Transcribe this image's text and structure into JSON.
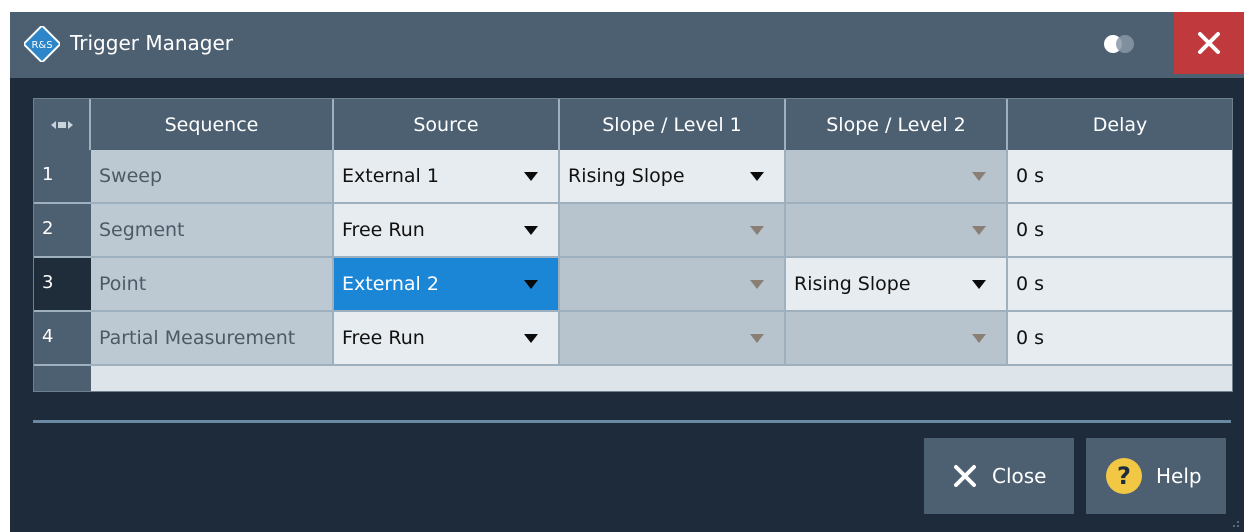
{
  "window": {
    "title": "Trigger Manager",
    "logo_text": "R&S",
    "close_icon": "close-icon",
    "toggle_icon": "toggle-icon"
  },
  "table": {
    "headers": {
      "expand_icon": "expand-columns-icon",
      "sequence": "Sequence",
      "source": "Source",
      "slope1": "Slope / Level 1",
      "slope2": "Slope / Level 2",
      "delay": "Delay"
    },
    "rows": [
      {
        "num": "1",
        "sequence": "Sweep",
        "source": "External 1",
        "slope1": "Rising Slope",
        "slope2": "",
        "delay": "0 s"
      },
      {
        "num": "2",
        "sequence": "Segment",
        "source": "Free Run",
        "slope1": "",
        "slope2": "",
        "delay": "0 s"
      },
      {
        "num": "3",
        "sequence": "Point",
        "source": "External 2",
        "slope1": "",
        "slope2": "Rising Slope",
        "delay": "0 s"
      },
      {
        "num": "4",
        "sequence": "Partial Measurement",
        "source": "Free Run",
        "slope1": "",
        "slope2": "",
        "delay": "0 s"
      }
    ]
  },
  "buttons": {
    "close_label": "Close",
    "help_label": "Help",
    "help_glyph": "?"
  },
  "colors": {
    "accent_selected": "#1b86d6",
    "close_red": "#c0393c",
    "header": "#4d6072"
  }
}
